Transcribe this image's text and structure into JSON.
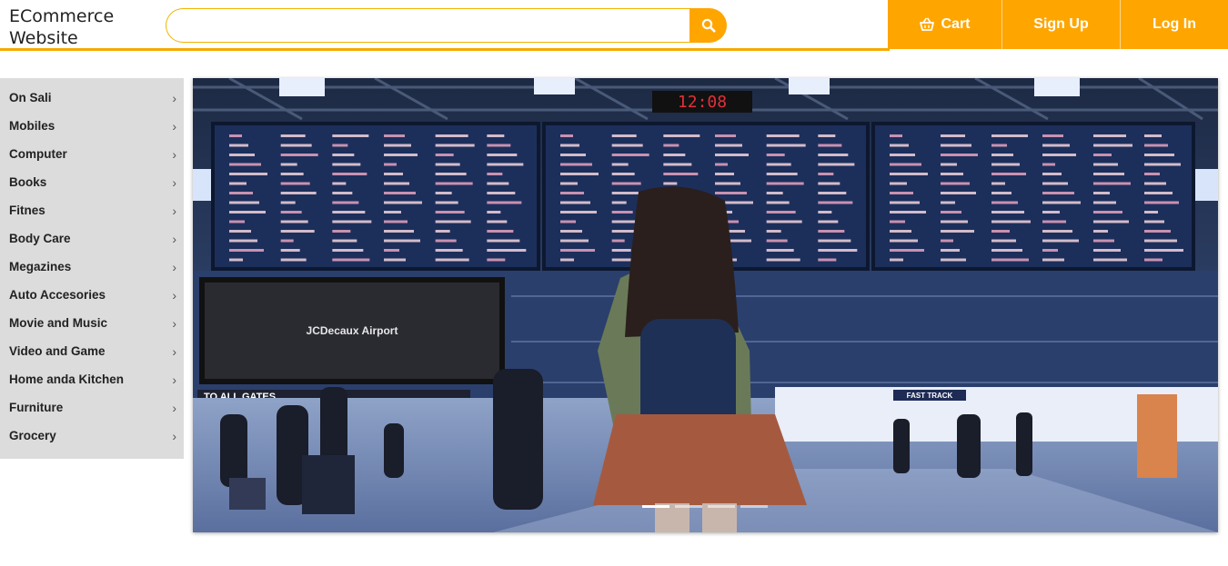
{
  "header": {
    "logo_line1": "ECommerce",
    "logo_line2": "Website",
    "search_value": "",
    "nav": {
      "cart_label": "Cart",
      "signup_label": "Sign Up",
      "login_label": "Log In"
    }
  },
  "sidebar": {
    "items": [
      {
        "label": "On Sali"
      },
      {
        "label": "Mobiles"
      },
      {
        "label": "Computer"
      },
      {
        "label": "Books"
      },
      {
        "label": "Fitnes"
      },
      {
        "label": "Body Care"
      },
      {
        "label": "Megazines"
      },
      {
        "label": "Auto Accesories"
      },
      {
        "label": "Movie and Music"
      },
      {
        "label": "Video and Game"
      },
      {
        "label": "Home anda Kitchen"
      },
      {
        "label": "Furniture"
      },
      {
        "label": "Grocery"
      }
    ]
  },
  "carousel": {
    "clock_text": "12:08",
    "screen_text": "JCDecaux Airport",
    "gate_text": "TO ALL GATES",
    "fast_track_text": "FAST TRACK",
    "slide_count": 4,
    "active_slide": 1
  },
  "colors": {
    "accent": "#ffa500",
    "sidebar_bg": "#dcdcdc"
  },
  "icons": {
    "search": "search-icon",
    "cart": "cart-icon",
    "chevron": "chevron-right-icon"
  }
}
